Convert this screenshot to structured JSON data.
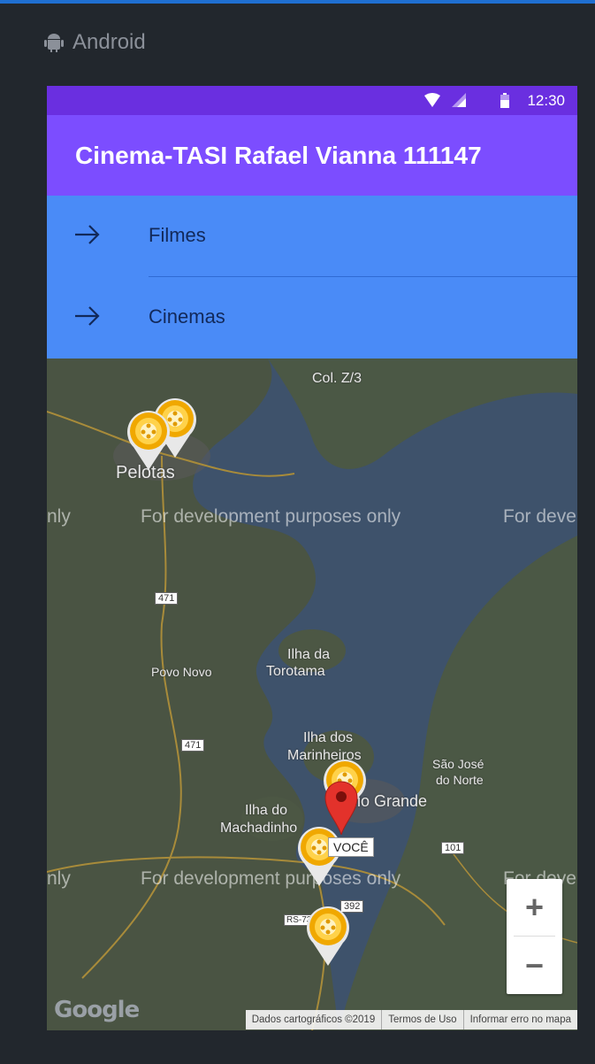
{
  "os": {
    "label": "Android"
  },
  "statusbar": {
    "time": "12:30"
  },
  "appbar": {
    "title": "Cinema-TASI Rafael Vianna 111147"
  },
  "menu": {
    "items": [
      {
        "label": "Filmes"
      },
      {
        "label": "Cinemas"
      }
    ]
  },
  "map": {
    "places": {
      "col_z3": "Col. Z/3",
      "pelotas": "Pelotas",
      "povo_novo": "Povo Novo",
      "ilha_torotama_1": "Ilha da",
      "ilha_torotama_2": "Torotama",
      "ilha_marinheiros_1": "Ilha dos",
      "ilha_marinheiros_2": "Marinheiros",
      "sao_jose_1": "São José",
      "sao_jose_2": "do Norte",
      "rio_grande": "Rio Grande",
      "ilha_machadinho_1": "Ilha do",
      "ilha_machadinho_2": "Machadinho"
    },
    "road_shields": {
      "r471a": "471",
      "r471b": "471",
      "r101": "101",
      "r392": "392",
      "rs734": "RS-734"
    },
    "watermark": "For development purposes only",
    "watermark_left_fragment": "nly",
    "watermark_right_fragment": "For deve",
    "you_label": "VOCÊ",
    "zoom_in": "+",
    "zoom_out": "−",
    "google": "Google",
    "attribution": {
      "data": "Dados cartográficos ©2019",
      "terms": "Termos de Uso",
      "report": "Informar erro no mapa"
    }
  }
}
